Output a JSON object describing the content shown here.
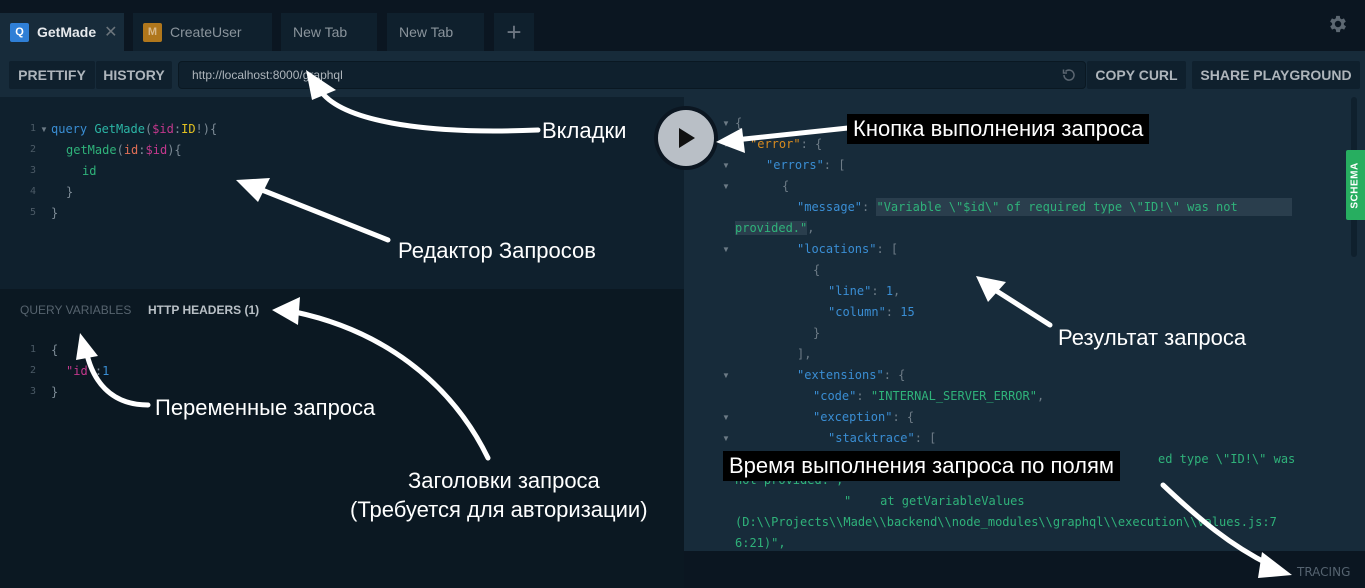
{
  "tabs": [
    {
      "label": "GetMade",
      "badge": "Q",
      "badge_color": "#2f7fd6",
      "active": true,
      "closable": true
    },
    {
      "label": "CreateUser",
      "badge": "M",
      "badge_color": "#b0771c",
      "active": false
    },
    {
      "label": "New Tab",
      "active": false
    },
    {
      "label": "New Tab",
      "active": false
    }
  ],
  "tab_add_label": "+",
  "toolbar": {
    "prettify": "PRETTIFY",
    "history": "HISTORY",
    "url": "http://localhost:8000/graphql",
    "copy_curl": "COPY CURL",
    "share": "SHARE PLAYGROUND"
  },
  "editor": {
    "line_numbers": [
      "1",
      "2",
      "3",
      "4",
      "5"
    ]
  },
  "variables": {
    "tab_query_variables": "QUERY VARIABLES",
    "tab_http_headers": "HTTP HEADERS (1)",
    "line_numbers": [
      "1",
      "2",
      "3"
    ]
  },
  "result": {
    "message": "\"Variable \\\"$id\\\" of required type \\\"ID!\\\" was not",
    "message_cont": "provided.\"",
    "line": "1",
    "column": "15",
    "code": "\"INTERNAL_SERVER_ERROR\"",
    "stack_1": "ed type \\\"ID!\\\" was",
    "stack_2": "not provided.\",",
    "stack_3": "\"    at getVariableValues",
    "stack_4": "(D:\\\\Projects\\\\Made\\\\backend\\\\node_modules\\\\graphql\\\\execution\\\\values.js:7",
    "stack_5": "6:21)\","
  },
  "schema_label": "SCHEMA",
  "tracing_label": "TRACING",
  "annotations": {
    "tabs": "Вкладки",
    "run_button": "Кнопка выполнения запроса",
    "editor": "Редактор Запросов",
    "result": "Результат запроса",
    "variables": "Переменные запроса",
    "headers_line1": "Заголовки запроса",
    "headers_line2": "(Требуется для авторизации)",
    "tracing": "Время выполнения запроса по полям"
  }
}
